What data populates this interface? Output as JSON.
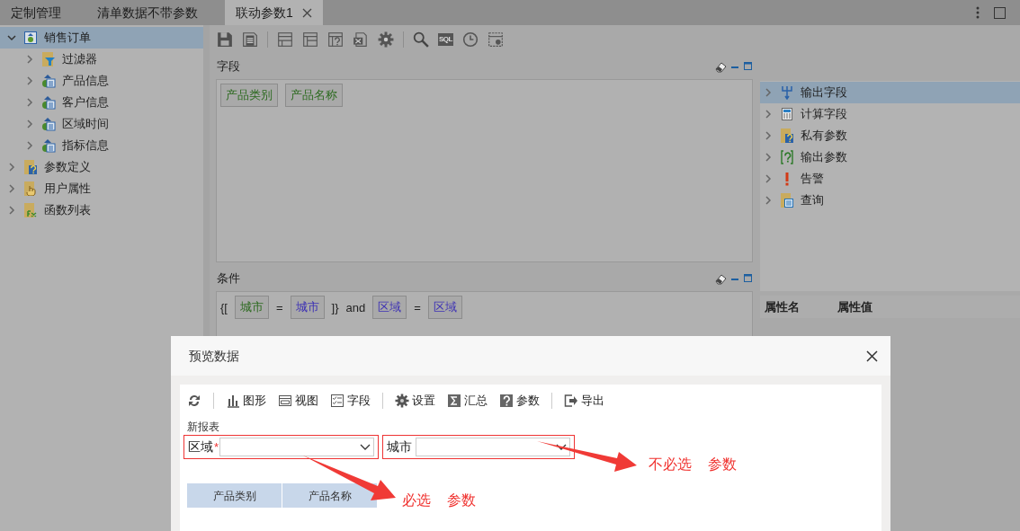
{
  "tabs": [
    {
      "label": "定制管理",
      "selected": false,
      "closable": false
    },
    {
      "label": "清单数据不带参数",
      "selected": false,
      "closable": false
    },
    {
      "label": "联动参数1",
      "selected": true,
      "closable": true
    }
  ],
  "left_tree": [
    {
      "label": "销售订单",
      "kind": "dataset",
      "selected": true,
      "expanded": true,
      "children": [
        {
          "label": "过滤器",
          "kind": "filter",
          "selected": false,
          "expanded": false
        },
        {
          "label": "产品信息",
          "kind": "table",
          "selected": false,
          "expanded": false
        },
        {
          "label": "客户信息",
          "kind": "table",
          "selected": false,
          "expanded": false
        },
        {
          "label": "区域时间",
          "kind": "table",
          "selected": false,
          "expanded": false
        },
        {
          "label": "指标信息",
          "kind": "table",
          "selected": false,
          "expanded": false
        }
      ]
    },
    {
      "label": "参数定义",
      "kind": "param-folder",
      "selected": false,
      "expanded": false
    },
    {
      "label": "用户属性",
      "kind": "hand-folder",
      "selected": false,
      "expanded": false
    },
    {
      "label": "函数列表",
      "kind": "fx-folder",
      "selected": false,
      "expanded": false
    }
  ],
  "toolbar": [
    {
      "kind": "save"
    },
    {
      "kind": "save-as"
    },
    {
      "kind": "separator"
    },
    {
      "kind": "layout"
    },
    {
      "kind": "grid"
    },
    {
      "kind": "param"
    },
    {
      "kind": "export"
    },
    {
      "kind": "gear"
    },
    {
      "kind": "separator"
    },
    {
      "kind": "search"
    },
    {
      "kind": "sql",
      "text": "SQL"
    },
    {
      "kind": "clock"
    },
    {
      "kind": "dashed"
    }
  ],
  "fields_panel": {
    "title": "字段",
    "chips": [
      "产品类别",
      "产品名称"
    ]
  },
  "conditions_panel": {
    "title": "条件",
    "tokens": [
      {
        "kind": "text",
        "text": "{["
      },
      {
        "kind": "field",
        "text": "城市"
      },
      {
        "kind": "text",
        "text": "="
      },
      {
        "kind": "param",
        "text": "城市"
      },
      {
        "kind": "text",
        "text": "]}"
      },
      {
        "kind": "text",
        "text": "and"
      },
      {
        "kind": "param",
        "text": "区域"
      },
      {
        "kind": "text",
        "text": "="
      },
      {
        "kind": "param",
        "text": "区域"
      }
    ]
  },
  "right_tree": [
    {
      "label": "输出字段",
      "kind": "output-field",
      "selected": true
    },
    {
      "label": "计算字段",
      "kind": "calc",
      "selected": false
    },
    {
      "label": "私有参数",
      "kind": "param-folder",
      "selected": false
    },
    {
      "label": "输出参数",
      "kind": "output-param",
      "selected": false
    },
    {
      "label": "告警",
      "kind": "alert",
      "selected": false
    },
    {
      "label": "查询",
      "kind": "query-folder",
      "selected": false
    }
  ],
  "properties": {
    "columns": [
      "属性名",
      "属性值"
    ]
  },
  "dialog": {
    "title": "预览数据",
    "toolbar": [
      {
        "kind": "refresh"
      },
      {
        "kind": "separator"
      },
      {
        "kind": "chart",
        "label": "图形"
      },
      {
        "kind": "view",
        "label": "视图"
      },
      {
        "kind": "fields",
        "label": "字段"
      },
      {
        "kind": "separator"
      },
      {
        "kind": "gear",
        "label": "设置"
      },
      {
        "kind": "sum",
        "label": "汇总"
      },
      {
        "kind": "help",
        "label": "参数"
      },
      {
        "kind": "separator"
      },
      {
        "kind": "export",
        "label": "导出"
      }
    ],
    "report_title": "新报表",
    "filters": [
      {
        "label": "区域",
        "required": true,
        "required_mark": "*",
        "highlighted": true
      },
      {
        "label": "城市",
        "required": false,
        "highlighted": true
      }
    ],
    "table": {
      "columns": [
        "产品类别",
        "产品名称"
      ]
    }
  },
  "annotations": [
    {
      "words": [
        "必选",
        "参数"
      ]
    },
    {
      "words": [
        "不必选",
        "参数"
      ]
    }
  ]
}
